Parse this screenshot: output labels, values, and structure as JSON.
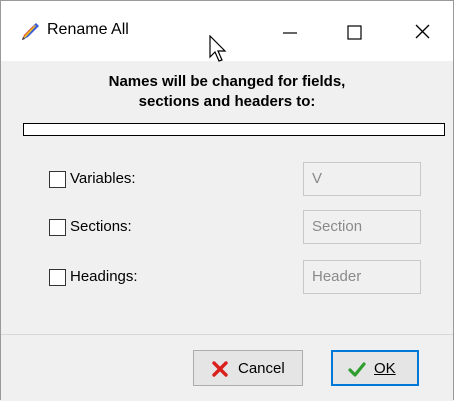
{
  "window": {
    "title": "Rename All",
    "icon": "rainbow-pencil-icon"
  },
  "heading": {
    "line1": "Names will be changed for fields,",
    "line2": "sections and headers to:"
  },
  "preview_value": "",
  "options": [
    {
      "label": "Variables:",
      "value": "V",
      "checked": false
    },
    {
      "label": "Sections:",
      "value": "Section",
      "checked": false
    },
    {
      "label": "Headings:",
      "value": "Header",
      "checked": false
    }
  ],
  "buttons": {
    "cancel_label": "Cancel",
    "ok_label": "OK"
  },
  "colors": {
    "ok_focus_border": "#0078d7",
    "cancel_x": "#d9201a",
    "ok_check": "#2e9e2e"
  }
}
